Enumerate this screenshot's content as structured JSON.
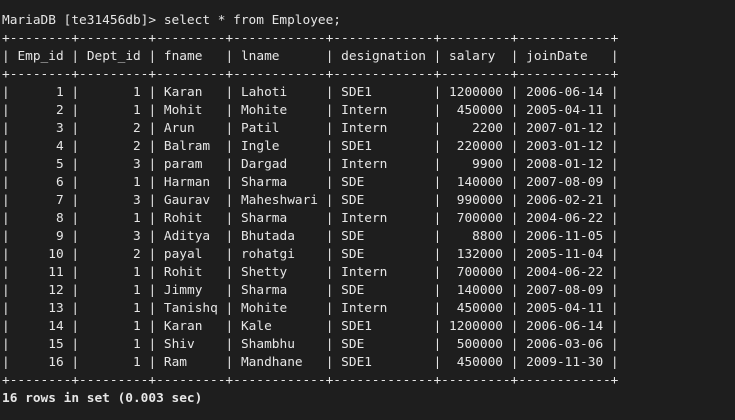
{
  "terminal": {
    "prompt": "MariaDB [te31456db]>",
    "command": "select * from Employee;",
    "summary": "16 rows in set (0.003 sec)"
  },
  "table": {
    "columns": [
      "Emp_id",
      "Dept_id",
      "fname",
      "lname",
      "designation",
      "salary",
      "joinDate"
    ],
    "rows": [
      [
        "1",
        "1",
        "Karan",
        "Lahoti",
        "SDE1",
        "1200000",
        "2006-06-14"
      ],
      [
        "2",
        "1",
        "Mohit",
        "Mohite",
        "Intern",
        "450000",
        "2005-04-11"
      ],
      [
        "3",
        "2",
        "Arun",
        "Patil",
        "Intern",
        "2200",
        "2007-01-12"
      ],
      [
        "4",
        "2",
        "Balram",
        "Ingle",
        "SDE1",
        "220000",
        "2003-01-12"
      ],
      [
        "5",
        "3",
        "param",
        "Dargad",
        "Intern",
        "9900",
        "2008-01-12"
      ],
      [
        "6",
        "1",
        "Harman",
        "Sharma",
        "SDE",
        "140000",
        "2007-08-09"
      ],
      [
        "7",
        "3",
        "Gaurav",
        "Maheshwari",
        "SDE",
        "990000",
        "2006-02-21"
      ],
      [
        "8",
        "1",
        "Rohit",
        "Sharma",
        "Intern",
        "700000",
        "2004-06-22"
      ],
      [
        "9",
        "3",
        "Aditya",
        "Bhutada",
        "SDE",
        "8800",
        "2006-11-05"
      ],
      [
        "10",
        "2",
        "payal",
        "rohatgi",
        "SDE",
        "132000",
        "2005-11-04"
      ],
      [
        "11",
        "1",
        "Rohit",
        "Shetty",
        "Intern",
        "700000",
        "2004-06-22"
      ],
      [
        "12",
        "1",
        "Jimmy",
        "Sharma",
        "SDE",
        "140000",
        "2007-08-09"
      ],
      [
        "13",
        "1",
        "Tanishq",
        "Mohite",
        "Intern",
        "450000",
        "2005-04-11"
      ],
      [
        "14",
        "1",
        "Karan",
        "Kale",
        "SDE1",
        "1200000",
        "2006-06-14"
      ],
      [
        "15",
        "1",
        "Shiv",
        "Shambhu",
        "SDE",
        "500000",
        "2006-03-06"
      ],
      [
        "16",
        "1",
        "Ram",
        "Mandhane",
        "SDE1",
        "450000",
        "2009-11-30"
      ]
    ]
  },
  "colors": {
    "background": "#1e1e1e",
    "text": "#e6e6e6"
  }
}
